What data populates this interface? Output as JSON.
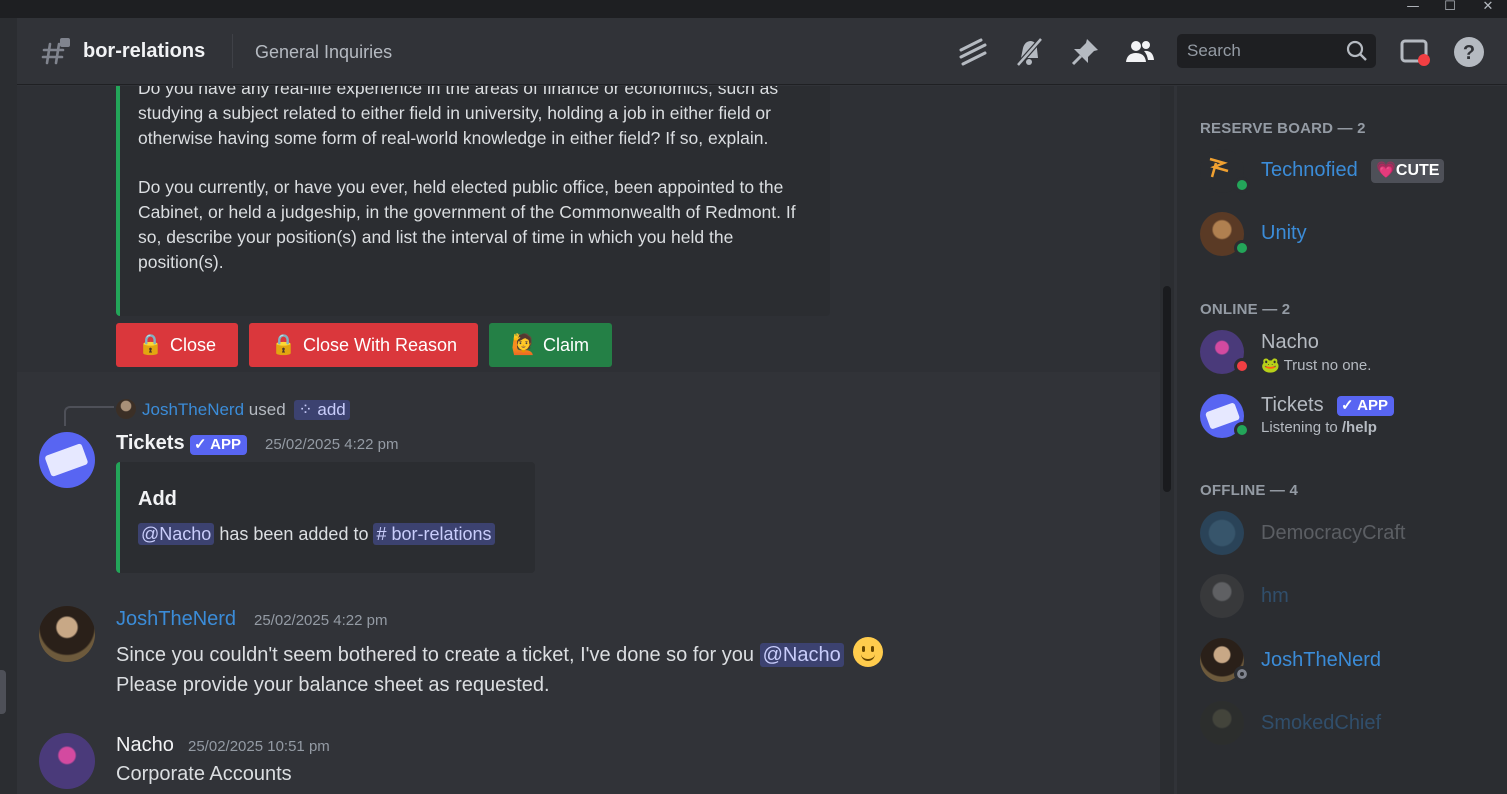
{
  "window": {
    "minimize": "—",
    "maximize": "☐",
    "close": "✕"
  },
  "header": {
    "channel": "bor-relations",
    "topic": "General Inquiries",
    "search_placeholder": "Search",
    "icons": [
      "threads-icon",
      "mute-bell-icon",
      "pin-icon",
      "members-icon",
      "inbox-icon",
      "help-icon"
    ]
  },
  "embed_form": {
    "text": "Do you have any real-life experience in the areas of finance or economics, such as studying a subject related to either field in university, holding a job in either field or otherwise having some form of real-world knowledge in either field? If so, explain.\n\nDo you currently, or have you ever, held elected public office, been appointed to the Cabinet, or held a judgeship, in the government of the Commonwealth of Redmont. If so, describe your position(s) and list the interval of time in which you held the position(s).",
    "buttons": [
      {
        "label": "Close",
        "icon": "🔒",
        "color": "#da373c"
      },
      {
        "label": "Close With Reason",
        "icon": "🔒",
        "color": "#da373c"
      },
      {
        "label": "Claim",
        "icon": "🙋",
        "color": "#248046"
      }
    ]
  },
  "messages": [
    {
      "reply": {
        "user": "JoshTheNerd",
        "used": "used",
        "command": "add"
      },
      "author": "Tickets",
      "badge": "✓ APP",
      "time": "25/02/2025 4:22 pm",
      "embed": {
        "title": "Add",
        "mention": "@Nacho",
        "text": "has been added to",
        "channel": "# bor-relations"
      }
    },
    {
      "author": "JoshTheNerd",
      "time": "25/02/2025 4:22 pm",
      "line1": "Since you couldn't seem bothered to create a ticket, I've done so for you",
      "mention": "@Nacho",
      "line2": "Please provide your balance sheet as requested."
    },
    {
      "author": "Nacho",
      "time": "25/02/2025 10:51 pm",
      "line1": "Corporate Accounts"
    }
  ],
  "members": {
    "sections": [
      {
        "title": "RESERVE BOARD — 2",
        "items": [
          {
            "name": "Technofied",
            "tag": "💗CUTE",
            "color": "#3b8cd8",
            "status": "online"
          },
          {
            "name": "Unity",
            "color": "#3b8cd8",
            "status": "online"
          }
        ]
      },
      {
        "title": "ONLINE — 2",
        "items": [
          {
            "name": "Nacho",
            "sub": "🐸 Trust no one.",
            "color": "#b5bac1",
            "status": "dnd"
          },
          {
            "name": "Tickets",
            "badge": "✓ APP",
            "sub_prefix": "Listening to ",
            "sub_bold": "/help",
            "color": "#b5bac1",
            "status": "online"
          }
        ]
      },
      {
        "title": "OFFLINE — 4",
        "items": [
          {
            "name": "DemocracyCraft",
            "color": "#b5bac1"
          },
          {
            "name": "hm",
            "color": "#3b8cd8"
          },
          {
            "name": "JoshTheNerd",
            "color": "#3b8cd8"
          },
          {
            "name": "SmokedChief",
            "color": "#3b8cd8"
          }
        ]
      }
    ]
  },
  "colors": {
    "online": "#23a559",
    "dnd": "#f23f43",
    "accent": "#5865f2",
    "link_blue": "#3b8cd8"
  }
}
